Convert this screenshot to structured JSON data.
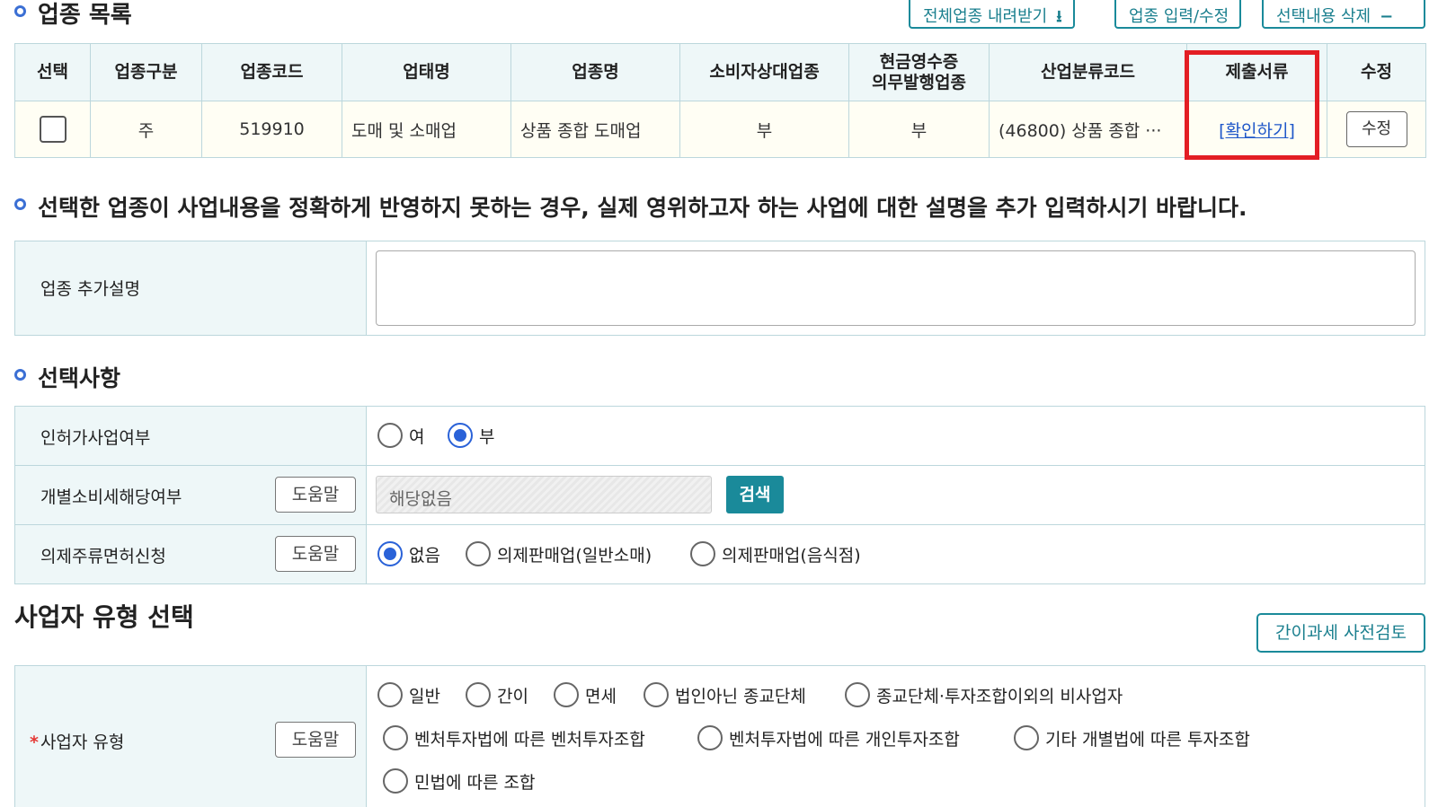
{
  "section1": {
    "title": "업종 목록",
    "buttons": {
      "download_all": "전체업종 내려받기",
      "input_edit": "업종 입력/수정",
      "delete_selected": "선택내용 삭제"
    }
  },
  "table": {
    "headers": {
      "select": "선택",
      "type": "업종구분",
      "code": "업종코드",
      "business_form": "업태명",
      "business_name": "업종명",
      "consumer": "소비자상대업종",
      "cash_receipt_line1": "현금영수증",
      "cash_receipt_line2": "의무발행업종",
      "industry_code": "산업분류코드",
      "documents": "제출서류",
      "edit": "수정"
    },
    "row": {
      "type": "주",
      "code": "519910",
      "business_form": "도매 및 소매업",
      "business_name": "상품 종합 도매업",
      "consumer": "부",
      "cash_receipt": "부",
      "industry_code": "(46800) 상품 종합 ···",
      "documents_link": "[확인하기]",
      "edit_button": "수정"
    }
  },
  "section2": {
    "title": "선택한 업종이 사업내용을 정확하게 반영하지 못하는 경우, 실제 영위하고자 하는 사업에 대한 설명을 추가 입력하시기 바랍니다.",
    "label": "업종 추가설명"
  },
  "options": {
    "title": "선택사항",
    "license": {
      "label": "인허가사업여부",
      "yes": "여",
      "no": "부"
    },
    "excise": {
      "label": "개별소비세해당여부",
      "help": "도움말",
      "value": "해당없음",
      "search": "검색"
    },
    "liquor": {
      "label": "의제주류면허신청",
      "help": "도움말",
      "opt1": "없음",
      "opt2": "의제판매업(일반소매)",
      "opt3": "의제판매업(음식점)"
    }
  },
  "biztype": {
    "title": "사업자 유형 선택",
    "pre_review": "간이과세 사전검토",
    "required_mark": "*",
    "label": "사업자 유형",
    "help": "도움말",
    "opts": [
      "일반",
      "간이",
      "면세",
      "법인아닌 종교단체",
      "종교단체·투자조합이외의 비사업자",
      "벤처투자법에 따른 벤처투자조합",
      "벤처투자법에 따른 개인투자조합",
      "기타 개별법에 따른 투자조합",
      "민법에 따른 조합"
    ]
  },
  "colors": {
    "accent": "#1a8a9a",
    "radio_selected": "#2a62d8",
    "highlight": "#e31e24",
    "header_bg": "#eef7f8",
    "row_bg": "#fffef4"
  }
}
